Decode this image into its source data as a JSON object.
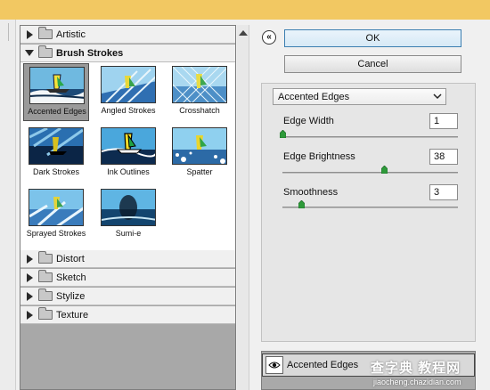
{
  "filter_tree": {
    "categories": [
      {
        "label": "Artistic",
        "expanded": false
      },
      {
        "label": "Brush Strokes",
        "expanded": true
      },
      {
        "label": "Distort",
        "expanded": false
      },
      {
        "label": "Sketch",
        "expanded": false
      },
      {
        "label": "Stylize",
        "expanded": false
      },
      {
        "label": "Texture",
        "expanded": false
      }
    ],
    "brush_strokes_filters": [
      {
        "label": "Accented Edges",
        "selected": true
      },
      {
        "label": "Angled Strokes",
        "selected": false
      },
      {
        "label": "Crosshatch",
        "selected": false
      },
      {
        "label": "Dark Strokes",
        "selected": false
      },
      {
        "label": "Ink Outlines",
        "selected": false
      },
      {
        "label": "Spatter",
        "selected": false
      },
      {
        "label": "Sprayed Strokes",
        "selected": false
      },
      {
        "label": "Sumi-e",
        "selected": false
      }
    ]
  },
  "buttons": {
    "ok_label": "OK",
    "cancel_label": "Cancel",
    "collapse_glyph": "«"
  },
  "filter_select": {
    "value": "Accented Edges"
  },
  "parameters": [
    {
      "label": "Edge Width",
      "value": "1",
      "min": 1,
      "max": 14,
      "level": 1
    },
    {
      "label": "Edge Brightness",
      "value": "38",
      "min": 0,
      "max": 50,
      "level": 38
    },
    {
      "label": "Smoothness",
      "value": "3",
      "min": 1,
      "max": 15,
      "level": 3
    }
  ],
  "effect_layers": [
    {
      "label": "Accented Edges",
      "visible": true
    }
  ],
  "watermark": {
    "line1": "查字典 教程网",
    "line2": "jiaocheng.chazidian.com"
  },
  "colors": {
    "title_bar": "#f2c862",
    "ok_border": "#3c7fb1",
    "slider_knob": "#2e9a3a"
  },
  "icons": {
    "expand": "triangle-right-icon",
    "collapse": "triangle-down-icon",
    "folder": "folder-icon",
    "visibility": "eye-icon",
    "panel_toggle": "double-chevron-up-icon",
    "dropdown": "chevron-down-icon"
  }
}
